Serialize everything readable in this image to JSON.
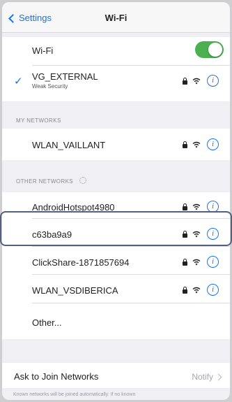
{
  "nav": {
    "back_label": "Settings",
    "title": "Wi-Fi"
  },
  "wifi_toggle": {
    "label": "Wi-Fi",
    "state": "on",
    "color": "#4caf50"
  },
  "current_network": {
    "name": "VG_EXTERNAL",
    "subtitle": "Weak Security",
    "connected": true
  },
  "my_networks": {
    "header": "MY NETWORKS",
    "items": [
      {
        "name": "WLAN_VAILLANT",
        "secured": true
      }
    ]
  },
  "other_networks": {
    "header": "OTHER NETWORKS",
    "items": [
      {
        "name": "AndroidHotspot4980",
        "secured": true
      },
      {
        "name": "c63ba9a9",
        "secured": true,
        "highlighted": true
      },
      {
        "name": "ClickShare-1871857694",
        "secured": true
      },
      {
        "name": "WLAN_VSDIBERICA",
        "secured": true
      }
    ],
    "other_label": "Other..."
  },
  "ask_to_join": {
    "label": "Ask to Join Networks",
    "value": "Notify"
  },
  "footer_text": "Known networks will be joined automatically. If no known",
  "colors": {
    "accent": "#1a73e8",
    "highlight_border": "#52617f"
  },
  "icons": [
    "chevron-left-icon",
    "checkmark-icon",
    "lock-icon",
    "wifi-icon",
    "info-icon",
    "spinner-icon",
    "chevron-right-icon"
  ]
}
